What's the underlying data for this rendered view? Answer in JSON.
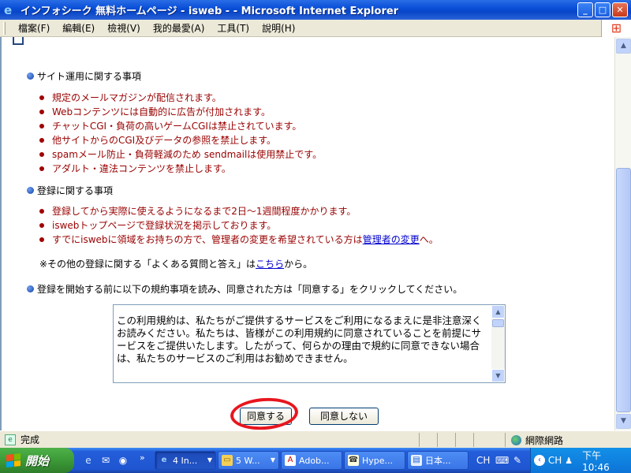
{
  "window": {
    "title": "インフォシーク 無料ホームページ - isweb - - Microsoft Internet Explorer",
    "minimize": "_",
    "maximize": "□",
    "close": "✕"
  },
  "menu": {
    "items": [
      "檔案(F)",
      "編輯(E)",
      "檢視(V)",
      "我的最愛(A)",
      "工具(T)",
      "說明(H)"
    ]
  },
  "page": {
    "section1": {
      "heading": "サイト運用に関する事項",
      "items": [
        "規定のメールマガジンが配信されます。",
        "Webコンテンツには自動的に広告が付加されます。",
        "チャットCGI・負荷の高いゲームCGIは禁止されています。",
        "他サイトからのCGI及びデータの参照を禁止します。",
        "spamメール防止・負荷軽減のため sendmailは使用禁止です。",
        "アダルト・違法コンテンツを禁止します。"
      ]
    },
    "section2": {
      "heading": "登録に関する事項",
      "items": [
        "登録してから実際に使えるようになるまで2日〜1週間程度かかります。",
        "iswebトップページで登録状況を掲示しております。"
      ],
      "item3_prefix": "すでにiswebに領域をお持ちの方で、管理者の変更を希望されている方は",
      "item3_link": "管理者の変更",
      "item3_suffix": "へ。"
    },
    "note": {
      "prefix": "※その他の登録に関する「よくある質問と答え」は",
      "link": "こちら",
      "suffix": "から。"
    },
    "section3": {
      "heading": "登録を開始する前に以下の規約事項を読み、同意された方は「同意する」をクリックしてください。"
    },
    "terms_text": "この利用規約は、私たちがご提供するサービスをご利用になるまえに是非注意深くお読みください。私たちは、皆様がこの利用規約に同意されていることを前提にサービスをご提供いたします。したがって、何らかの理由で規約に同意できない場合は、私たちのサービスのご利用はお勧めできません。",
    "agree_button": "同意する",
    "disagree_button": "同意しない"
  },
  "statusbar": {
    "status": "完成",
    "zone": "網際網路"
  },
  "taskbar": {
    "start": "開始",
    "tasks": [
      {
        "label": "4 In...",
        "icon": "ie-icon"
      },
      {
        "label": "5 W...",
        "icon": "folder-icon"
      },
      {
        "label": "Adob...",
        "icon": "acrobat-icon"
      },
      {
        "label": "Hype...",
        "icon": "hyperterminal-icon"
      },
      {
        "label": "日本...",
        "icon": "document-icon"
      }
    ],
    "lang": "CH",
    "tray_lang": "CH",
    "clock": "下午 10:46"
  },
  "colors": {
    "title_blue": "#0a4fd8",
    "list_red": "#990000",
    "link_blue": "#0000cc",
    "highlight_circle": "#e8161e"
  }
}
